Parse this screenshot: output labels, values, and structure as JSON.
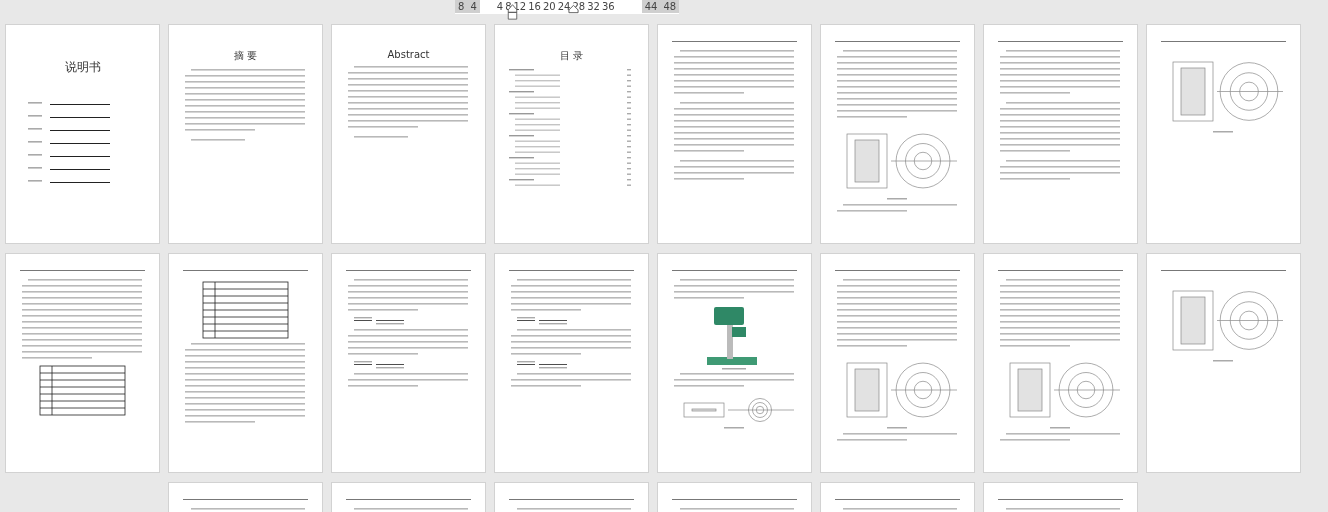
{
  "ruler": {
    "ticks": [
      {
        "label": "8",
        "margin": true
      },
      {
        "label": "4",
        "margin": true
      },
      {
        "label": "4",
        "margin": false
      },
      {
        "label": "8",
        "margin": false
      },
      {
        "label": "12",
        "margin": false
      },
      {
        "label": "16",
        "margin": false
      },
      {
        "label": "20",
        "margin": false
      },
      {
        "label": "24",
        "margin": false
      },
      {
        "label": "28",
        "margin": false
      },
      {
        "label": "32",
        "margin": false
      },
      {
        "label": "36",
        "margin": false
      },
      {
        "label": "44",
        "margin": true
      },
      {
        "label": "48",
        "margin": true
      }
    ]
  },
  "rows": [
    {
      "pages": [
        {
          "kind": "cover",
          "title": "说明书",
          "header": false
        },
        {
          "kind": "abstract",
          "title": "摘 要",
          "header": false
        },
        {
          "kind": "abstract",
          "title": "Abstract",
          "header": false
        },
        {
          "kind": "toc",
          "title": "目 录",
          "header": false
        },
        {
          "kind": "text",
          "header": true
        },
        {
          "kind": "text-figure",
          "header": true
        },
        {
          "kind": "text",
          "header": true
        },
        {
          "kind": "figure",
          "header": true
        }
      ]
    },
    {
      "pages": [
        {
          "kind": "text-table",
          "header": true
        },
        {
          "kind": "table",
          "header": true
        },
        {
          "kind": "formula",
          "header": true
        },
        {
          "kind": "formula",
          "header": true
        },
        {
          "kind": "photo",
          "header": true
        },
        {
          "kind": "text-figure",
          "header": true
        },
        {
          "kind": "text-figure",
          "header": true
        },
        {
          "kind": "figure",
          "header": true
        }
      ]
    },
    {
      "pages": [
        {
          "kind": "stub",
          "header": true
        },
        {
          "kind": "stub",
          "header": true
        },
        {
          "kind": "stub",
          "header": true
        },
        {
          "kind": "stub",
          "header": true
        },
        {
          "kind": "stub",
          "header": true
        },
        {
          "kind": "stub",
          "header": true
        }
      ]
    }
  ]
}
